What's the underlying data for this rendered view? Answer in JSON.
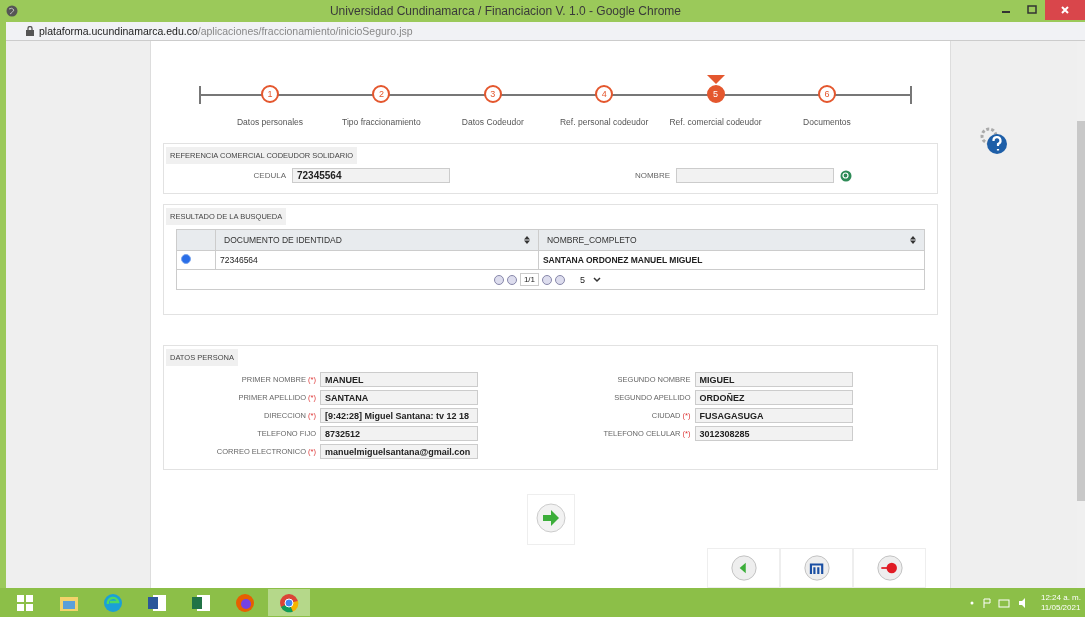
{
  "window": {
    "title": "Universidad Cundinamarca / Financiacion V. 1.0 - Google Chrome"
  },
  "address_bar": {
    "host": "plataforma.ucundinamarca.edu.co",
    "path": "/aplicaciones/fraccionamiento/inicioSeguro.jsp"
  },
  "steps": [
    {
      "number": "1",
      "label": "Datos personales",
      "selected": false
    },
    {
      "number": "2",
      "label": "Tipo fraccionamiento",
      "selected": false
    },
    {
      "number": "3",
      "label": "Datos Codeudor",
      "selected": false
    },
    {
      "number": "4",
      "label": "Ref. personal codeudor",
      "selected": false
    },
    {
      "number": "5",
      "label": "Ref. comercial codeudor",
      "selected": true
    },
    {
      "number": "6",
      "label": "Documentos",
      "selected": false
    }
  ],
  "search_section": {
    "legend": "REFERENCIA COMERCIAL CODEUDOR SOLIDARIO",
    "cedula_label": "CEDULA",
    "cedula_value": "72345564",
    "nombre_label": "NOMBRE"
  },
  "results": {
    "legend": "RESULTADO DE LA BUSQUEDA",
    "columns": [
      "DOCUMENTO DE IDENTIDAD",
      "NOMBRE_COMPLETO"
    ],
    "rows": [
      {
        "selected": true,
        "cells": [
          "72346564",
          "SANTANA ORDONEZ MANUEL MIGUEL"
        ]
      }
    ],
    "page_report": "1/1",
    "rows_per_page": "5"
  },
  "person": {
    "legend": "DATOS PERSONA",
    "fields": [
      {
        "label": "PRIMER NOMBRE",
        "required_mark": "(*)",
        "value": "MANUEL"
      },
      {
        "label": "SEGUNDO NOMBRE",
        "value": "MIGUEL"
      },
      {
        "label": "PRIMER APELLIDO",
        "required_mark": "(*)",
        "value": "SANTANA"
      },
      {
        "label": "SEGUNDO APELLIDO",
        "value": "ORDOÑEZ"
      },
      {
        "label": "DIRECCION",
        "required_mark": "(*)",
        "value": "[9:42:28] Miguel Santana: tv 12 18"
      },
      {
        "label": "CIUDAD",
        "required_mark": "(*)",
        "value": "FUSAGASUGA"
      },
      {
        "label": "TELEFONO FIJO",
        "value": "8732512"
      },
      {
        "label": "TELEFONO CELULAR",
        "required_mark": "(*)",
        "value": "3012308285"
      },
      {
        "label": "CORREO ELECTRONICO",
        "required_mark": "(*)",
        "value": "manuelmiguelsantana@gmail.con"
      }
    ]
  },
  "taskbar": {
    "time": "12:24 a. m.",
    "date": "11/05/2021"
  }
}
